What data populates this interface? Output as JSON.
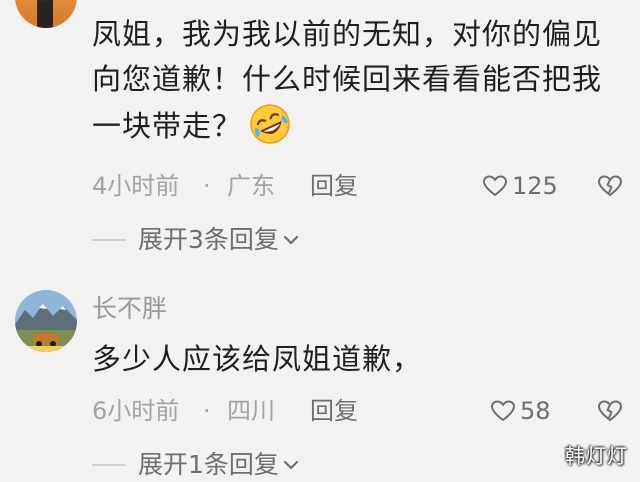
{
  "comments": [
    {
      "text": "凤姐，我为我以前的无知，对你的偏见向您道歉！什么时候回来看看能否把我一块带走？",
      "emoji": "rolling-laughing-emoji",
      "time": "4小时前",
      "dot": "·",
      "location": "广东",
      "reply_label": "回复",
      "likes": "125",
      "expand_label": "展开3条回复"
    },
    {
      "username": "长不胖",
      "text": "多少人应该给凤姐道歉，",
      "time": "6小时前",
      "dot": "·",
      "location": "四川",
      "reply_label": "回复",
      "likes": "58",
      "expand_label": "展开1条回复"
    }
  ],
  "icons": {
    "like": "heart-outline-icon",
    "dislike": "broken-heart-icon",
    "expand": "chevron-down-icon"
  },
  "watermark": "韩灯灯",
  "colors": {
    "background": "#f2f2f2",
    "text": "#1f1f1f",
    "meta": "#a3a3a3",
    "action": "#6e6e6e"
  }
}
